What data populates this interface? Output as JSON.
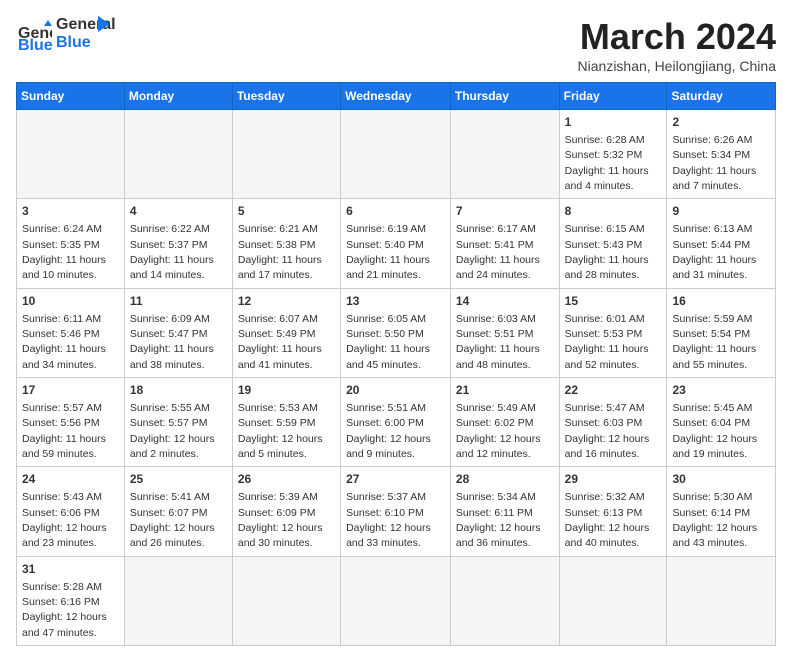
{
  "header": {
    "logo_general": "General",
    "logo_blue": "Blue",
    "month_title": "March 2024",
    "subtitle": "Nianzishan, Heilongjiang, China"
  },
  "weekdays": [
    "Sunday",
    "Monday",
    "Tuesday",
    "Wednesday",
    "Thursday",
    "Friday",
    "Saturday"
  ],
  "days": {
    "1": {
      "info": "Sunrise: 6:28 AM\nSunset: 5:32 PM\nDaylight: 11 hours and 4 minutes."
    },
    "2": {
      "info": "Sunrise: 6:26 AM\nSunset: 5:34 PM\nDaylight: 11 hours and 7 minutes."
    },
    "3": {
      "info": "Sunrise: 6:24 AM\nSunset: 5:35 PM\nDaylight: 11 hours and 10 minutes."
    },
    "4": {
      "info": "Sunrise: 6:22 AM\nSunset: 5:37 PM\nDaylight: 11 hours and 14 minutes."
    },
    "5": {
      "info": "Sunrise: 6:21 AM\nSunset: 5:38 PM\nDaylight: 11 hours and 17 minutes."
    },
    "6": {
      "info": "Sunrise: 6:19 AM\nSunset: 5:40 PM\nDaylight: 11 hours and 21 minutes."
    },
    "7": {
      "info": "Sunrise: 6:17 AM\nSunset: 5:41 PM\nDaylight: 11 hours and 24 minutes."
    },
    "8": {
      "info": "Sunrise: 6:15 AM\nSunset: 5:43 PM\nDaylight: 11 hours and 28 minutes."
    },
    "9": {
      "info": "Sunrise: 6:13 AM\nSunset: 5:44 PM\nDaylight: 11 hours and 31 minutes."
    },
    "10": {
      "info": "Sunrise: 6:11 AM\nSunset: 5:46 PM\nDaylight: 11 hours and 34 minutes."
    },
    "11": {
      "info": "Sunrise: 6:09 AM\nSunset: 5:47 PM\nDaylight: 11 hours and 38 minutes."
    },
    "12": {
      "info": "Sunrise: 6:07 AM\nSunset: 5:49 PM\nDaylight: 11 hours and 41 minutes."
    },
    "13": {
      "info": "Sunrise: 6:05 AM\nSunset: 5:50 PM\nDaylight: 11 hours and 45 minutes."
    },
    "14": {
      "info": "Sunrise: 6:03 AM\nSunset: 5:51 PM\nDaylight: 11 hours and 48 minutes."
    },
    "15": {
      "info": "Sunrise: 6:01 AM\nSunset: 5:53 PM\nDaylight: 11 hours and 52 minutes."
    },
    "16": {
      "info": "Sunrise: 5:59 AM\nSunset: 5:54 PM\nDaylight: 11 hours and 55 minutes."
    },
    "17": {
      "info": "Sunrise: 5:57 AM\nSunset: 5:56 PM\nDaylight: 11 hours and 59 minutes."
    },
    "18": {
      "info": "Sunrise: 5:55 AM\nSunset: 5:57 PM\nDaylight: 12 hours and 2 minutes."
    },
    "19": {
      "info": "Sunrise: 5:53 AM\nSunset: 5:59 PM\nDaylight: 12 hours and 5 minutes."
    },
    "20": {
      "info": "Sunrise: 5:51 AM\nSunset: 6:00 PM\nDaylight: 12 hours and 9 minutes."
    },
    "21": {
      "info": "Sunrise: 5:49 AM\nSunset: 6:02 PM\nDaylight: 12 hours and 12 minutes."
    },
    "22": {
      "info": "Sunrise: 5:47 AM\nSunset: 6:03 PM\nDaylight: 12 hours and 16 minutes."
    },
    "23": {
      "info": "Sunrise: 5:45 AM\nSunset: 6:04 PM\nDaylight: 12 hours and 19 minutes."
    },
    "24": {
      "info": "Sunrise: 5:43 AM\nSunset: 6:06 PM\nDaylight: 12 hours and 23 minutes."
    },
    "25": {
      "info": "Sunrise: 5:41 AM\nSunset: 6:07 PM\nDaylight: 12 hours and 26 minutes."
    },
    "26": {
      "info": "Sunrise: 5:39 AM\nSunset: 6:09 PM\nDaylight: 12 hours and 30 minutes."
    },
    "27": {
      "info": "Sunrise: 5:37 AM\nSunset: 6:10 PM\nDaylight: 12 hours and 33 minutes."
    },
    "28": {
      "info": "Sunrise: 5:34 AM\nSunset: 6:11 PM\nDaylight: 12 hours and 36 minutes."
    },
    "29": {
      "info": "Sunrise: 5:32 AM\nSunset: 6:13 PM\nDaylight: 12 hours and 40 minutes."
    },
    "30": {
      "info": "Sunrise: 5:30 AM\nSunset: 6:14 PM\nDaylight: 12 hours and 43 minutes."
    },
    "31": {
      "info": "Sunrise: 5:28 AM\nSunset: 6:16 PM\nDaylight: 12 hours and 47 minutes."
    }
  }
}
